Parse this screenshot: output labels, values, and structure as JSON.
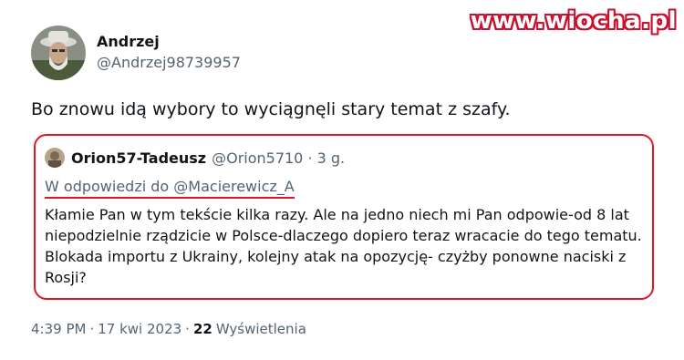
{
  "watermark": "www.wiocha.pl",
  "tweet": {
    "author_name": "Andrzej",
    "author_handle": "@Andrzej98739957",
    "text": "Bo znowu idą wybory to wyciągnęli stary temat z szafy."
  },
  "quote": {
    "author_name": "Orion57-Tadeusz",
    "author_handle": "@Orion5710 · 3 g.",
    "reply_to": "W odpowiedzi do @Macierewicz_A",
    "text": "Kłamie Pan w tym tekście kilka razy. Ale na jedno niech mi Pan odpowie-od 8 lat niepodzielnie rządzicie w Polsce-dlaczego dopiero teraz wracacie do tego tematu. Blokada importu z Ukrainy, kolejny atak na opozycję- czyżby ponowne naciski z Rosji?",
    "highlight_color": "#e0172b"
  },
  "meta": {
    "time": "4:39 PM",
    "separator": "·",
    "date": "17 kwi 2023",
    "views_count": "22",
    "views_label": "Wyświetlenia"
  }
}
